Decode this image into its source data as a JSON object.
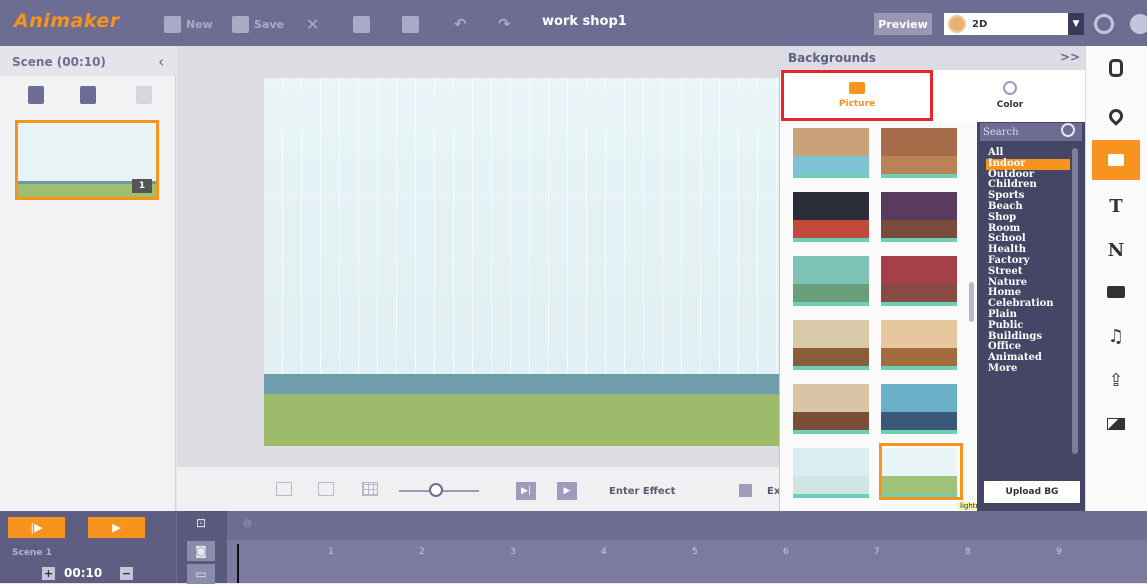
{
  "app": {
    "logo_text": "Animaker",
    "project_title": "work shop1"
  },
  "toolbar": {
    "new_label": "New",
    "save_label": "Save",
    "preview_label": "Preview",
    "mode_value": "2D"
  },
  "scene_panel": {
    "title": "Scene  (00:10)",
    "thumbnail_number": "1"
  },
  "canvas_toolbar": {
    "enter_effect_label": "Enter Effect",
    "exit_effect_label": "Exit Effect"
  },
  "backgrounds": {
    "title": "Backgrounds",
    "collapse_label": ">>",
    "tab_picture": "Picture",
    "tab_color": "Color",
    "search_placeholder": "Search",
    "tooltip": "lightroom",
    "categories": [
      "All",
      "Indoor",
      "Outdoor",
      "Children",
      "Sports",
      "Beach",
      "Shop",
      "Room",
      "School",
      "Health",
      "Factory",
      "Street",
      "Nature",
      "Home",
      "Celebration",
      "Plain",
      "Public",
      "Buildings",
      "Office",
      "Animated",
      "More"
    ],
    "active_category": "Indoor",
    "upload_label": "Upload BG"
  },
  "right_sidebar": {
    "items": [
      "character-icon",
      "location-icon",
      "background-icon",
      "text-icon",
      "number-icon",
      "props-icon",
      "music-icon",
      "upload-icon",
      "effects-icon"
    ],
    "text_glyph": "T",
    "number_glyph": "N"
  },
  "timeline": {
    "scene_label": "Scene 1",
    "time_value": "00:10",
    "ticks": [
      "1",
      "2",
      "3",
      "4",
      "5",
      "6",
      "7",
      "8",
      "9"
    ]
  },
  "colors": {
    "accent": "#f7941d",
    "toolbar": "#6d6d93",
    "highlight_red": "#e8262a"
  }
}
